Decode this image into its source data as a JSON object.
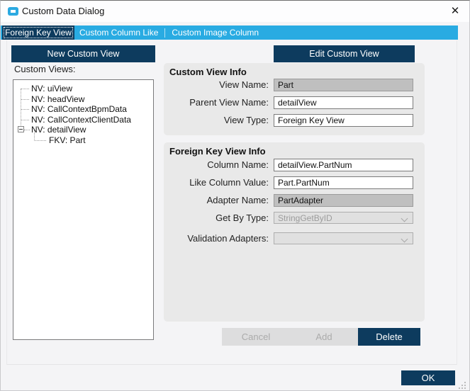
{
  "window": {
    "title": "Custom Data Dialog"
  },
  "icons": {
    "close": "✕"
  },
  "tabs": {
    "tab1": "Foreign Key View",
    "tab2": "Custom Column Like",
    "tab3": "Custom Image Column"
  },
  "toolbar": {
    "new_button": "New Custom View",
    "edit_button": "Edit Custom View"
  },
  "tree": {
    "label": "Custom Views:",
    "items": [
      {
        "label": "NV: uiView"
      },
      {
        "label": "NV: headView"
      },
      {
        "label": "NV: CallContextBpmData"
      },
      {
        "label": "NV: CallContextClientData"
      },
      {
        "label": "NV: detailView",
        "expanded": true
      },
      {
        "label": "FKV: Part",
        "child": true
      }
    ]
  },
  "custom_view_info": {
    "title": "Custom View Info",
    "view_name": {
      "label": "View Name:",
      "value": "Part",
      "state": "readonly"
    },
    "parent_view_name": {
      "label": "Parent View Name:",
      "value": "detailView",
      "state": "editable"
    },
    "view_type": {
      "label": "View Type:",
      "value": "Foreign Key View",
      "state": "editable"
    }
  },
  "foreign_key_view_info": {
    "title": "Foreign Key View Info",
    "column_name": {
      "label": "Column Name:",
      "value": "detailView.PartNum",
      "state": "editable"
    },
    "like_column_value": {
      "label": "Like Column Value:",
      "value": "Part.PartNum",
      "state": "editable"
    },
    "adapter_name": {
      "label": "Adapter Name:",
      "value": "PartAdapter",
      "state": "readonly"
    },
    "get_by_type": {
      "label": "Get By Type:",
      "value": "StringGetByID",
      "state": "disabled-dropdown"
    },
    "validation_adapters": {
      "label": "Validation Adapters:",
      "value": "",
      "state": "disabled-dropdown"
    }
  },
  "actions": {
    "cancel": "Cancel",
    "add": "Add",
    "delete": "Delete",
    "ok": "OK"
  },
  "colors": {
    "accent_blue": "#29ABE2",
    "navy": "#0D3B5E",
    "panel_gray": "#E9E9E9",
    "disabled_field": "#BFBFBF"
  }
}
